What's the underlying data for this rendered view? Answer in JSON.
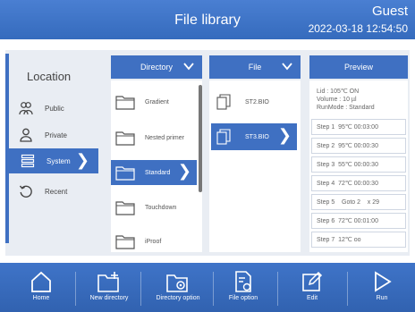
{
  "header": {
    "title": "File library",
    "user": "Guest",
    "datetime": "2022-03-18 12:54:50",
    "color": "#3f70c2"
  },
  "location": {
    "title": "Location",
    "items": [
      {
        "label": "Public",
        "icon": "people-icon"
      },
      {
        "label": "Private",
        "icon": "person-icon"
      },
      {
        "label": "System",
        "icon": "list-icon",
        "selected": true
      },
      {
        "label": "Recent",
        "icon": "history-icon"
      }
    ]
  },
  "directory": {
    "header": "Directory",
    "items": [
      {
        "label": "Gradient"
      },
      {
        "label": "Nested primer"
      },
      {
        "label": "Standard",
        "selected": true
      },
      {
        "label": "Touchdown"
      },
      {
        "label": "iProof"
      }
    ]
  },
  "file": {
    "header": "File",
    "items": [
      {
        "label": "ST2.BIO"
      },
      {
        "label": "ST3.BIO",
        "selected": true
      }
    ]
  },
  "preview": {
    "header": "Preview",
    "lid": "Lid : 105℃  ON",
    "volume": "Volume : 10 µl",
    "runmode": "RunMode : Standard",
    "steps": [
      "Step 1  95℃ 00:03:00",
      "Step 2  95℃ 00:00:30",
      "Step 3  55℃ 00:00:30",
      "Step 4  72℃ 00:00:30",
      "Step 5    Goto 2    x 29",
      "Step 6  72℃ 00:01:00",
      "Step 7  12℃ oo"
    ]
  },
  "toolbar": {
    "home": "Home",
    "new_directory": "New directory",
    "directory_option": "Directory option",
    "file_option": "File option",
    "edit": "Edit",
    "run": "Run"
  }
}
